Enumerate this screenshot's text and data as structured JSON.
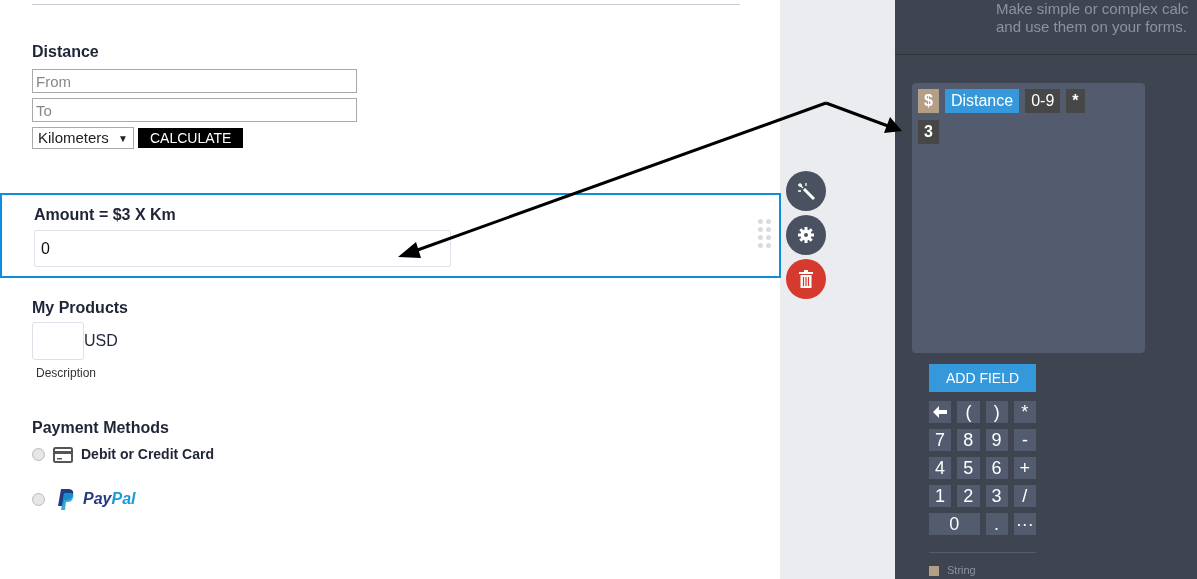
{
  "form": {
    "distance": {
      "label": "Distance",
      "from_placeholder": "From",
      "to_placeholder": "To",
      "unit": "Kilometers",
      "unit_caret": "▼",
      "button": "CALCULATE"
    },
    "amount": {
      "label": "Amount = $3 X Km",
      "value": "0",
      "selected": true
    },
    "products": {
      "label": "My Products",
      "currency": "USD",
      "description": "Description"
    },
    "payment": {
      "label": "Payment Methods",
      "options": [
        {
          "kind": "card",
          "label": "Debit or Credit Card",
          "selected": false
        },
        {
          "kind": "paypal",
          "label_part_1": "Pay",
          "label_part_2": "Pal",
          "selected": false
        }
      ]
    }
  },
  "side_panel": {
    "intro_1": "Make simple or complex calc",
    "intro_2": "and use them on your forms.",
    "expression_lines": [
      {
        "tokens": [
          {
            "text": "$",
            "color": "#b49f86"
          },
          {
            "text": "Distance",
            "color": "#3498db"
          },
          {
            "text": "0-9",
            "color": "#474747"
          },
          {
            "text": "*",
            "color": "#474747"
          }
        ]
      },
      {
        "tokens": [
          {
            "text": "3",
            "color": "#474747"
          }
        ]
      }
    ],
    "add_field": "ADD FIELD",
    "keys": [
      {
        "kind": "backspace"
      },
      {
        "kind": "key",
        "text": "("
      },
      {
        "kind": "key",
        "text": ")"
      },
      {
        "kind": "key",
        "text": "*"
      },
      {
        "kind": "key",
        "text": "7"
      },
      {
        "kind": "key",
        "text": "8"
      },
      {
        "kind": "key",
        "text": "9"
      },
      {
        "kind": "key",
        "text": "-"
      },
      {
        "kind": "key",
        "text": "4"
      },
      {
        "kind": "key",
        "text": "5"
      },
      {
        "kind": "key",
        "text": "6"
      },
      {
        "kind": "key",
        "text": "+"
      },
      {
        "kind": "key",
        "text": "1"
      },
      {
        "kind": "key",
        "text": "2"
      },
      {
        "kind": "key",
        "text": "3"
      },
      {
        "kind": "key",
        "text": "/"
      },
      {
        "kind": "wide",
        "text": "0"
      },
      {
        "kind": "key",
        "text": "."
      },
      {
        "kind": "key",
        "text": "···"
      }
    ],
    "legend": [
      {
        "text": "String",
        "color": "#b49f86"
      }
    ]
  }
}
